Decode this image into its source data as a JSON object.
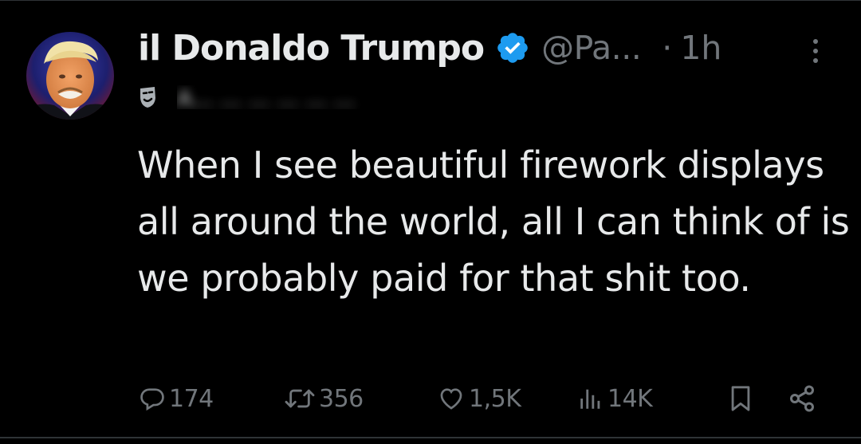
{
  "tweet": {
    "display_name": "il Donaldo Trumpo",
    "handle": "@Pa...",
    "separator": "·",
    "time": "1h",
    "affiliation_label": "A... ... ... ... ... ...",
    "text": "When I see beautiful firework displays all around the world, all I can think of is we probably paid for that shit too.",
    "icons": {
      "verified": "verified-badge-icon",
      "affiliation": "theater-masks-icon",
      "more": "more-vertical-icon"
    },
    "colors": {
      "background": "#000000",
      "text": "#e7e9ea",
      "secondary": "#71767b",
      "verified": "#1d9bf0"
    }
  },
  "actions": {
    "reply_count": "174",
    "repost_count": "356",
    "like_count": "1,5K",
    "views_count": "14K"
  }
}
